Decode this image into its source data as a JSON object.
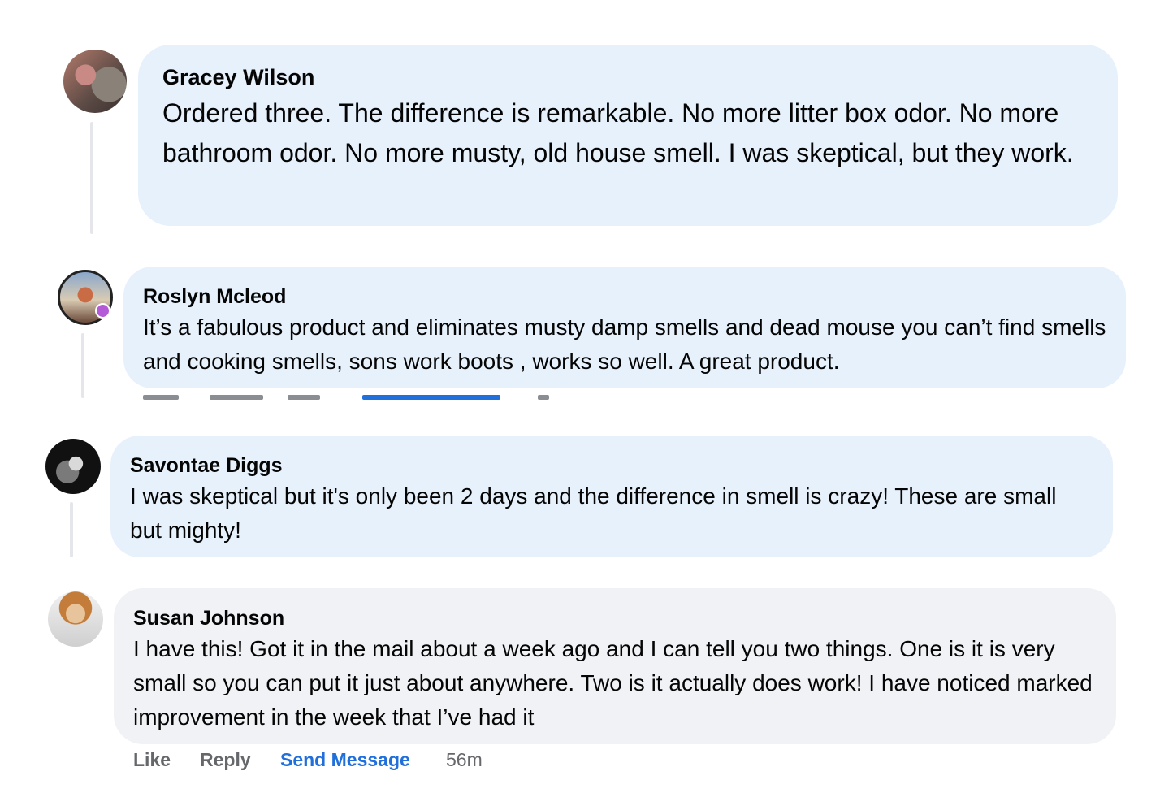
{
  "comments": [
    {
      "author": "Gracey Wilson",
      "text": "Ordered three. The difference is remarkable. No more litter box odor. No more bathroom odor. No more musty, old house smell. I was skeptical, but they work."
    },
    {
      "author": "Roslyn Mcleod",
      "text": "It’s a fabulous product and eliminates musty damp smells and dead mouse you can’t find smells and cooking smells, sons work boots , works so well. A great product."
    },
    {
      "author": "Savontae Diggs",
      "text": "I was skeptical but it's only been 2 days and the difference in smell is crazy! These are small but mighty!"
    },
    {
      "author": "Susan Johnson",
      "text": "I have this! Got it in the mail about a week ago and I can tell you two things. One is it is very small so you can put it just about anywhere. Two is it actually does work! I have noticed marked improvement in the week that I’ve had it",
      "actions": {
        "like": "Like",
        "reply": "Reply",
        "send_message": "Send Message",
        "time": "56m"
      }
    }
  ],
  "colors": {
    "bubble_highlight": "#e7f1fc",
    "bubble_default": "#f0f2f5",
    "link_blue": "#216fdb",
    "meta_gray": "#65676b"
  }
}
